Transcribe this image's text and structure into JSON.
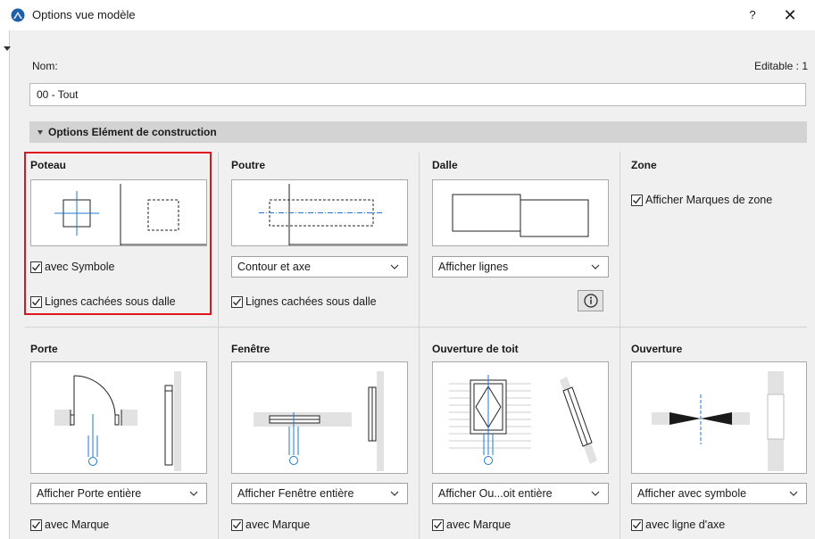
{
  "window": {
    "title": "Options vue modèle",
    "help_label": "?",
    "close_label": "✕"
  },
  "form": {
    "name_label": "Nom:",
    "editable_label": "Editable : 1",
    "name_value": "00 - Tout"
  },
  "section": {
    "title": "Options Elément de construction"
  },
  "poteau": {
    "title": "Poteau",
    "option1": "avec Symbole",
    "option2": "Lignes cachées sous dalle"
  },
  "poutre": {
    "title": "Poutre",
    "dropdown": "Contour et axe",
    "option1": "Lignes cachées sous dalle"
  },
  "dalle": {
    "title": "Dalle",
    "dropdown": "Afficher lignes"
  },
  "zone": {
    "title": "Zone",
    "option1": "Afficher Marques de zone"
  },
  "porte": {
    "title": "Porte",
    "dropdown": "Afficher Porte entière",
    "option1": "avec Marque"
  },
  "fenetre": {
    "title": "Fenêtre",
    "dropdown": "Afficher Fenêtre entière",
    "option1": "avec Marque"
  },
  "ouverture_toit": {
    "title": "Ouverture de toit",
    "dropdown": "Afficher Ou...oit entière",
    "option1": "avec Marque"
  },
  "ouverture": {
    "title": "Ouverture",
    "dropdown": "Afficher avec symbole",
    "option1": "avec ligne d'axe"
  },
  "colors": {
    "accent_blue": "#1e78d2",
    "highlight_red": "#e0141e",
    "section_grey": "#d3d3d3"
  },
  "icons": {
    "app": "archicad-icon",
    "info": "info-icon",
    "chevron": "chevron-down-icon",
    "check": "checkmark-icon"
  }
}
